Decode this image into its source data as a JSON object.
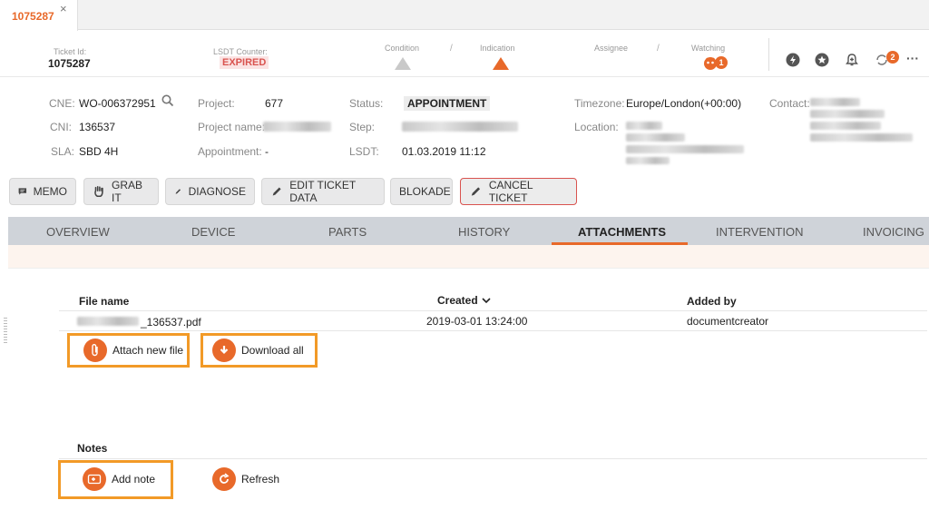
{
  "tab": {
    "title": "1075287",
    "close": "×"
  },
  "header": {
    "ticket_label": "Ticket Id:",
    "ticket_value": "1075287",
    "lsdt_label": "LSDT Counter:",
    "lsdt_value": "EXPIRED",
    "condition_label": "Condition",
    "slash": "/",
    "indication_label": "Indication",
    "assignee_label": "Assignee",
    "watching_label": "Watching",
    "watching_count": "1",
    "sync_count": "2",
    "more": "···"
  },
  "info": {
    "cne_label": "CNE:",
    "cne_value": "WO-006372951",
    "cni_label": "CNI:",
    "cni_value": "136537",
    "sla_label": "SLA:",
    "sla_value": "SBD 4H",
    "project_label": "Project:",
    "project_value": "677",
    "project_name_label": "Project name:",
    "appointment_label": "Appointment:",
    "appointment_value": "-",
    "status_label": "Status:",
    "status_value": "APPOINTMENT",
    "step_label": "Step:",
    "lsdt_label": "LSDT:",
    "lsdt_value": "01.03.2019 11:12",
    "timezone_label": "Timezone:",
    "timezone_value": "Europe/London(+00:00)",
    "location_label": "Location:",
    "contact_label": "Contact:"
  },
  "actions": {
    "memo": "MEMO",
    "grab": "GRAB IT",
    "diagnose": "DIAGNOSE",
    "edit": "EDIT TICKET DATA",
    "blokade": "BLOKADE",
    "cancel": "CANCEL TICKET"
  },
  "nav": {
    "overview": "OVERVIEW",
    "device": "DEVICE",
    "parts": "PARTS",
    "history": "HISTORY",
    "attachments": "ATTACHMENTS",
    "intervention": "INTERVENTION",
    "invoicing": "INVOICING"
  },
  "attachments": {
    "col_file": "File name",
    "col_created": "Created",
    "col_added": "Added by",
    "rows": [
      {
        "file_suffix": "_136537.pdf",
        "created": "2019-03-01 13:24:00",
        "added_by": "documentcreator"
      }
    ],
    "attach_new": "Attach new file",
    "download_all": "Download all"
  },
  "notes": {
    "title": "Notes",
    "add_note": "Add note",
    "refresh": "Refresh"
  },
  "colors": {
    "accent": "#e8692a",
    "highlight": "#f29a27",
    "danger": "#d9534f"
  }
}
